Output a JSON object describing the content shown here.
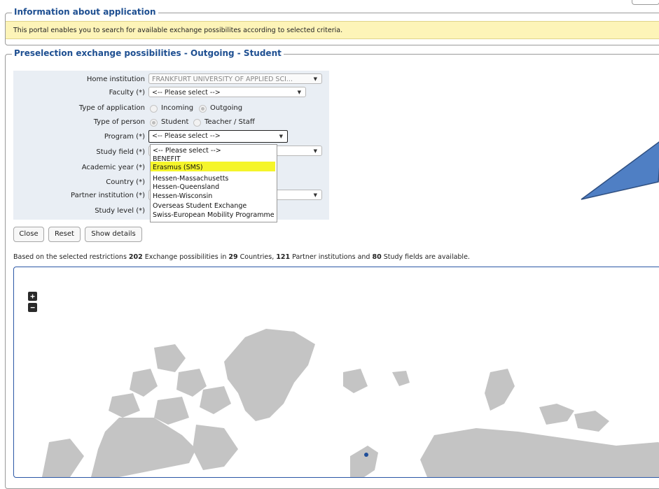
{
  "info": {
    "legend": "Information about application",
    "text": "This portal enables you to search for available exchange possibilites according to selected criteria."
  },
  "preselection": {
    "legend": "Preselection exchange possibilities - Outgoing - Student",
    "fields": {
      "home_institution": {
        "label": "Home institution",
        "value": "FRANKFURT UNIVERSITY OF APPLIED SCI..."
      },
      "faculty": {
        "label": "Faculty (*)",
        "value": "<-- Please select -->"
      },
      "type_of_application": {
        "label": "Type of application",
        "options": [
          "Incoming",
          "Outgoing"
        ],
        "selected": "Outgoing"
      },
      "type_of_person": {
        "label": "Type of person",
        "options": [
          "Student",
          "Teacher / Staff"
        ],
        "selected": "Student"
      },
      "program": {
        "label": "Program (*)",
        "value": "<-- Please select -->"
      },
      "study_field": {
        "label": "Study field (*)"
      },
      "academic_year": {
        "label": "Academic year (*)"
      },
      "country": {
        "label": "Country (*)"
      },
      "partner_institution": {
        "label": "Partner institution (*)"
      },
      "study_level": {
        "label": "Study level (*)"
      }
    },
    "program_dropdown": {
      "options": [
        "<-- Please select -->",
        "BENEFIT",
        "Erasmus (SMS)",
        "Hessen-Massachusetts",
        "Hessen-Queensland",
        "Hessen-Wisconsin",
        "Overseas Student Exchange",
        "Swiss-European Mobility Programme"
      ],
      "highlighted": "Erasmus (SMS)"
    },
    "buttons": {
      "close": "Close",
      "reset": "Reset",
      "show_details": "Show details"
    }
  },
  "summary": {
    "prefix": "Based on the selected restrictions ",
    "exchange_count": "202",
    "mid1": " Exchange possibilities in ",
    "country_count": "29",
    "mid2": " Countries, ",
    "partner_count": "121",
    "mid3": " Partner institutions and ",
    "field_count": "80",
    "suffix": " Study fields are available."
  },
  "map": {
    "zoom_in": "+",
    "zoom_out": "−",
    "land_color": "#c4c4c4",
    "marker_color": "#1f4e9a"
  },
  "colors": {
    "legend": "#1e4f91",
    "banner": "#fdf4b8",
    "highlight": "#f5f52a",
    "callout_fill": "#4f7fc4",
    "callout_stroke": "#2f4f80"
  }
}
